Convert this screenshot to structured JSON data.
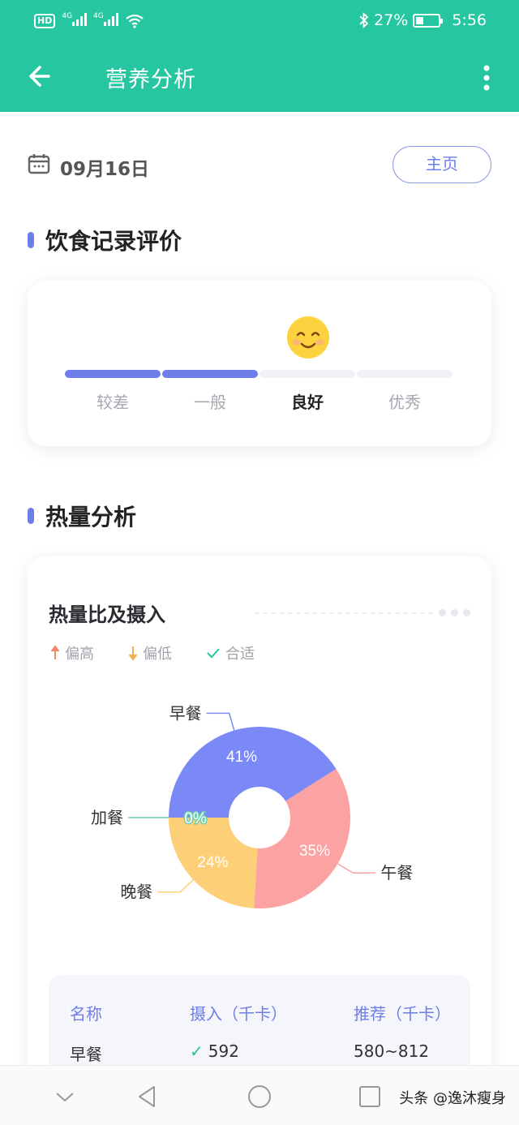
{
  "status": {
    "hd": "HD",
    "signal1": "4G",
    "signal2": "4G",
    "battery": "27%",
    "time": "5:56"
  },
  "topbar": {
    "title": "营养分析"
  },
  "date": {
    "text": "09月16日",
    "home_label": "主页"
  },
  "sections": {
    "diet": "饮食记录评价",
    "heat": "热量分析"
  },
  "rating": {
    "levels": [
      "较差",
      "一般",
      "良好",
      "优秀"
    ],
    "current_index": 2
  },
  "heat": {
    "chart_title": "热量比及摄入",
    "legend": {
      "high": "偏高",
      "low": "偏低",
      "ok": "合适"
    },
    "table": {
      "headers": [
        "名称",
        "摄入（千卡）",
        "推荐（千卡）"
      ],
      "rows": [
        {
          "name": "早餐",
          "intake": "592",
          "recommended": "580~812"
        }
      ]
    }
  },
  "chart_data": {
    "type": "pie",
    "categories": [
      "早餐",
      "午餐",
      "晚餐",
      "加餐"
    ],
    "values": [
      41,
      35,
      24,
      0
    ],
    "labels": [
      "41%",
      "35%",
      "24%",
      "0%"
    ],
    "colors": [
      "#7b89f7",
      "#fba2a2",
      "#fdd077",
      "#6fd1b1"
    ]
  },
  "watermark": "头条 @逸沐瘦身"
}
